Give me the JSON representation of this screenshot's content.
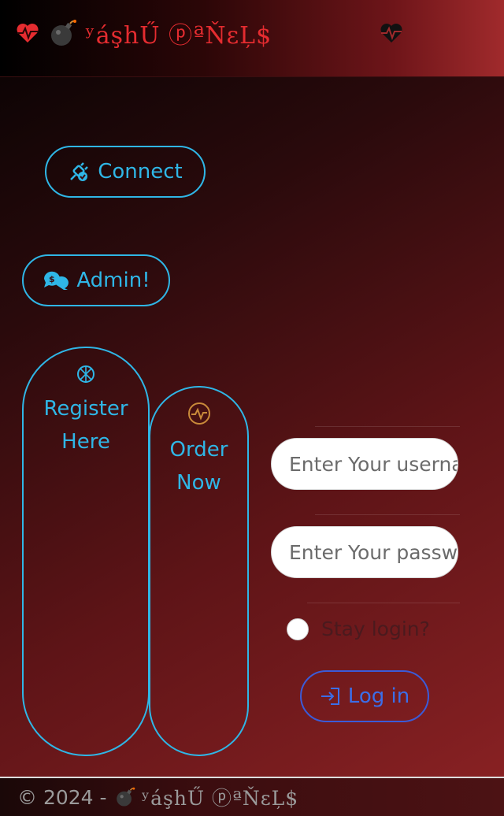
{
  "header": {
    "brand_name": "ʸáşhŰ ⓟªŇɛĻ$",
    "heart_icon": "heart-pulse-icon",
    "bomb_icon": "bomb-icon",
    "right_icon": "heartbeat-icon",
    "brand_color": "#e52c30"
  },
  "actions": {
    "connect_label": "Connect",
    "admin_label": "Admin!"
  },
  "cards": {
    "register_line1": "Register",
    "register_line2": "Here",
    "order_line1": "Order",
    "order_line2": "Now"
  },
  "login_form": {
    "username_placeholder": "Enter Your username",
    "password_placeholder": "Enter Your password",
    "stay_login_label": "Stay login?",
    "login_label": "Log in"
  },
  "footer": {
    "copyright": "© 2024 -",
    "brand_name": "ʸáşhŰ ⓟªŇɛĻ$"
  },
  "colors": {
    "accent": "#2fb6e6",
    "login_accent": "#3b6ee8",
    "header_red": "#a02a2c"
  }
}
